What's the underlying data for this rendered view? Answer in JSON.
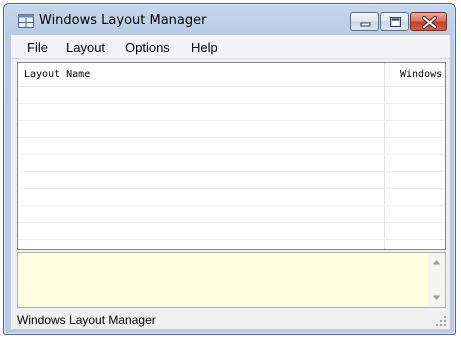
{
  "window": {
    "title": "Windows Layout Manager"
  },
  "menu": {
    "items": [
      "File",
      "Layout",
      "Options",
      "Help"
    ]
  },
  "list": {
    "columns": [
      "Layout Name",
      "Windows"
    ],
    "rows": []
  },
  "info_panel": {
    "text": "",
    "background": "#fdfde0"
  },
  "status": {
    "text": "Windows Layout Manager"
  }
}
